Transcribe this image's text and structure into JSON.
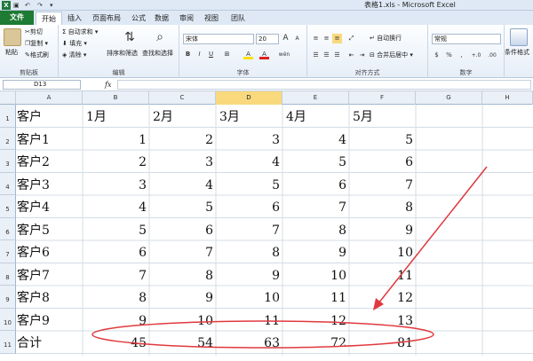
{
  "window": {
    "title": "表格1.xls - Microsoft Excel",
    "app_icon": "X"
  },
  "tabs": [
    "文件",
    "开始",
    "插入",
    "页面布局",
    "公式",
    "数据",
    "审阅",
    "视图",
    "团队"
  ],
  "ribbon": {
    "clipboard": {
      "paste": "粘贴",
      "cut": "剪切",
      "copy": "复制 ▾",
      "format_painter": "格式刷",
      "group": "剪贴板"
    },
    "editing": {
      "autosum": "自动求和 ▾",
      "fill": "填充 ▾",
      "clear": "清除 ▾",
      "sort_filter": "排序和筛选",
      "find_select": "查找和选择",
      "group": "编辑"
    },
    "font": {
      "name": "宋体",
      "size": "20",
      "grow": "A",
      "shrink": "A",
      "bold": "B",
      "italic": "I",
      "underline": "U",
      "border": "⊞",
      "fill_color": "A",
      "font_color": "A",
      "phonetic": "wén",
      "group": "字体"
    },
    "alignment": {
      "wrap": "自动换行",
      "merge": "合并后居中 ▾",
      "group": "对齐方式"
    },
    "number": {
      "format": "常规",
      "currency": "$",
      "percent": "%",
      "comma": ",",
      "inc": "+.0",
      "dec": ".00",
      "group": "数字"
    },
    "styles": {
      "cond": "条件格式"
    }
  },
  "formula_bar": {
    "name_box": "D13",
    "fx": "fx",
    "formula": ""
  },
  "columns": [
    "A",
    "B",
    "C",
    "D",
    "E",
    "F",
    "G",
    "H"
  ],
  "selected_column": "D",
  "rows": [
    "1",
    "2",
    "3",
    "4",
    "5",
    "6",
    "7",
    "8",
    "9",
    "10",
    "11"
  ],
  "sheet": [
    [
      "客户",
      "1月",
      "2月",
      "3月",
      "4月",
      "5月"
    ],
    [
      "客户1",
      "1",
      "2",
      "3",
      "4",
      "5"
    ],
    [
      "客户2",
      "2",
      "3",
      "4",
      "5",
      "6"
    ],
    [
      "客户3",
      "3",
      "4",
      "5",
      "6",
      "7"
    ],
    [
      "客户4",
      "4",
      "5",
      "6",
      "7",
      "8"
    ],
    [
      "客户5",
      "5",
      "6",
      "7",
      "8",
      "9"
    ],
    [
      "客户6",
      "6",
      "7",
      "8",
      "9",
      "10"
    ],
    [
      "客户7",
      "7",
      "8",
      "9",
      "10",
      "11"
    ],
    [
      "客户8",
      "8",
      "9",
      "10",
      "11",
      "12"
    ],
    [
      "客户9",
      "9",
      "10",
      "11",
      "12",
      "13"
    ],
    [
      "合计",
      "45",
      "54",
      "63",
      "72",
      "81"
    ]
  ],
  "annotation": {
    "color": "#e0393e"
  }
}
